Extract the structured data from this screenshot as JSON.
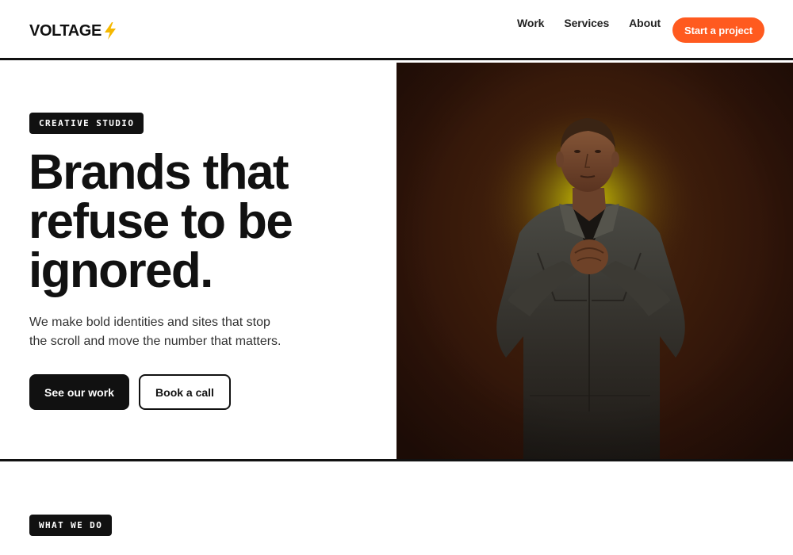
{
  "header": {
    "logo_text": "VOLTAGE",
    "logo_icon": "lightning-bolt-icon",
    "nav": [
      {
        "label": "Work"
      },
      {
        "label": "Services"
      },
      {
        "label": "About"
      }
    ],
    "cta_label": "Start a project"
  },
  "hero": {
    "tag": "CREATIVE STUDIO",
    "title_lines": [
      "Brands that",
      "refuse to be",
      "ignored."
    ],
    "subtitle_lines": [
      "We make bold identities and sites that stop",
      "the scroll and move the number that matters."
    ],
    "primary_button": "See our work",
    "secondary_button": "Book a call",
    "image": "portrait-photo"
  },
  "services": {
    "tag": "WHAT WE DO"
  },
  "colors": {
    "accent": "#ff5a1f",
    "ink": "#111111",
    "bolt": "#f5b800",
    "photo_background": "#3a1a0b"
  }
}
